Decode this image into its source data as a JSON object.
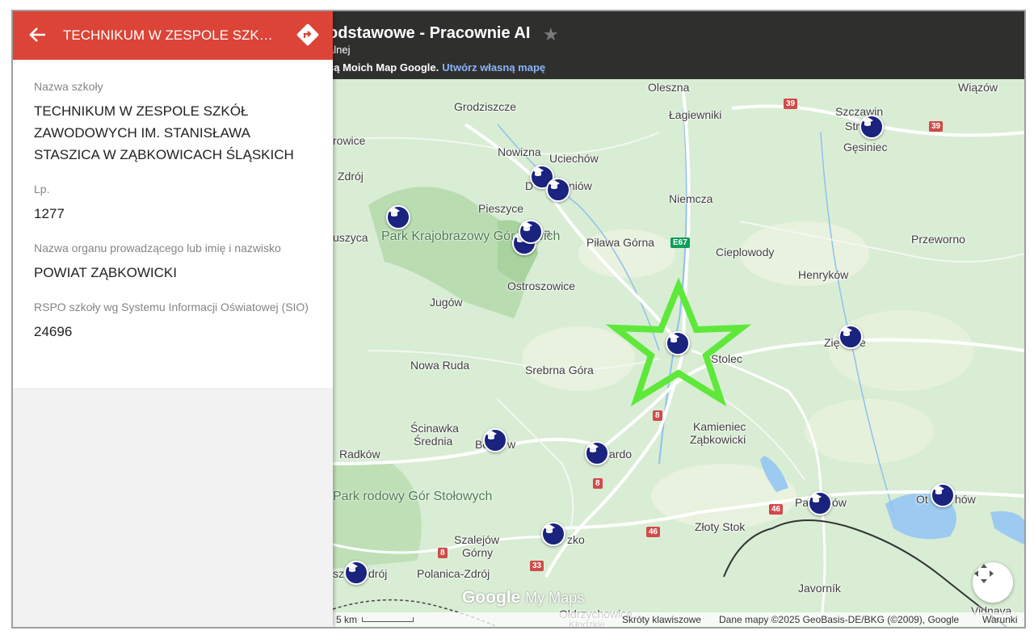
{
  "panel": {
    "title": "TECHNIKUM W ZESPOLE SZKÓŁ ZAWODOWYCH IM. STANISŁAWA STASZICA W ZĄBKOWICACH ŚLĄSKICH",
    "fields": [
      {
        "label": "Nazwa szkoły",
        "value": "TECHNIKUM W ZESPOLE SZKÓŁ ZAWODOWYCH IM. STANISŁAWA STASZICA W ZĄBKOWICACH ŚLĄSKICH"
      },
      {
        "label": "Lp.",
        "value": "1277"
      },
      {
        "label": "Nazwa organu prowadzącego lub imię i nazwisko",
        "value": "POWIAT ZĄBKOWICKI"
      },
      {
        "label": "RSPO szkoły wg Systemu Informacji Oświatowej (SIO)",
        "value": "24696"
      }
    ]
  },
  "map_header": {
    "title": "odstawowe - Pracownie AI",
    "subtitle": "alnej",
    "note": "cą Moich Map Google.",
    "create_link": "Utwórz własną mapę"
  },
  "places": [
    {
      "name": "Oleszna"
    },
    {
      "name": "Wiązów"
    },
    {
      "name": "Grodziszcze"
    },
    {
      "name": "Łagiewniki"
    },
    {
      "name": "Szczawin"
    },
    {
      "name": "Str"
    },
    {
      "name": "Gęsiniec"
    },
    {
      "name": "rowice"
    },
    {
      "name": "Nowizna"
    },
    {
      "name": "Uciechów"
    },
    {
      "name": "D"
    },
    {
      "name": "niów"
    },
    {
      "name": "Zdrój"
    },
    {
      "name": "Niemcza"
    },
    {
      "name": "Pieszyce"
    },
    {
      "name": "Bi"
    },
    {
      "name": "a"
    },
    {
      "name": "uszyca"
    },
    {
      "name": "Piława Górna"
    },
    {
      "name": "Cieplowody"
    },
    {
      "name": "Przeworno"
    },
    {
      "name": "Henryków"
    },
    {
      "name": "Ostroszowice"
    },
    {
      "name": "Jugów"
    },
    {
      "name": "Zię"
    },
    {
      "name": "e"
    },
    {
      "name": "Stolec"
    },
    {
      "name": "Nowa Ruda"
    },
    {
      "name": "Srebrna Góra"
    },
    {
      "name": "Kamieniec"
    },
    {
      "name": "Ząbkowicki"
    },
    {
      "name": "Ścinawka"
    },
    {
      "name": "Średnia"
    },
    {
      "name": "Bo"
    },
    {
      "name": "w"
    },
    {
      "name": "ardo"
    },
    {
      "name": "Radków"
    },
    {
      "name": "Pa"
    },
    {
      "name": "ów"
    },
    {
      "name": "Ot"
    },
    {
      "name": "hów"
    },
    {
      "name": "Złoty Stok"
    },
    {
      "name": "Szalejów"
    },
    {
      "name": "Górny"
    },
    {
      "name": "zko"
    },
    {
      "name": "Polanica-Zdrój"
    },
    {
      "name": "sz"
    },
    {
      "name": "drój"
    },
    {
      "name": "Javorník"
    },
    {
      "name": "Ołdrzychowice"
    },
    {
      "name": "Kłodzkie"
    },
    {
      "name": "Vidnava"
    }
  ],
  "parks": [
    {
      "name": "Park Krajobrazowy Gór Sowich"
    },
    {
      "name": "Park rodowy Gór Stołowych"
    }
  ],
  "roads": [
    "39",
    "39",
    "E67",
    "8",
    "8",
    "8",
    "46",
    "46",
    "33"
  ],
  "footer": {
    "scale": "5 km",
    "shortcuts": "Skróty klawiszowe",
    "map_data": "Dane mapy ©2025 GeoBasis-DE/BKG (©2009), Google",
    "terms": "Warunki"
  },
  "logo": {
    "google": "Google",
    "mymaps": "My Maps"
  },
  "colors": {
    "panel_header": "#db4437",
    "map_header": "#2f302e",
    "marker": "#1a237e",
    "highlight_star": "#5ee83a",
    "link": "#8ab4f8"
  },
  "icons": {
    "back": "arrow-left-icon",
    "directions": "directions-icon",
    "favorite": "star-icon",
    "share": "share-icon",
    "fullscreen": "fullscreen-icon",
    "marker": "graduation-cap-icon",
    "recenter": "recenter-icon"
  }
}
